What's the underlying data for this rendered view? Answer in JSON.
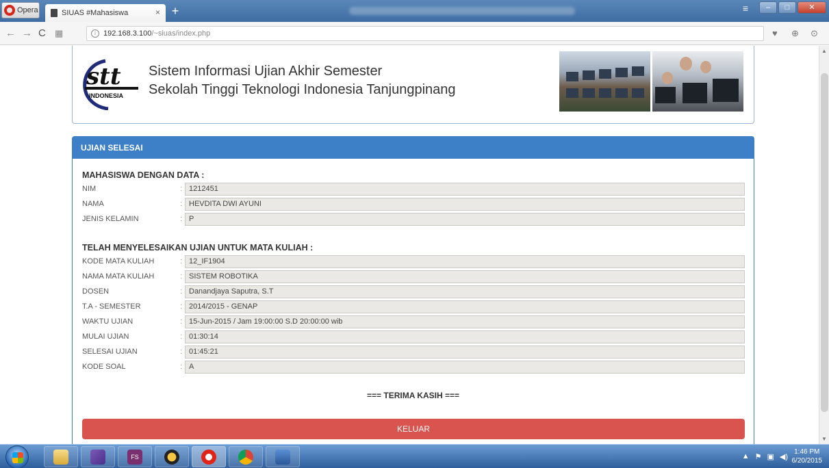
{
  "browser": {
    "menu_label": "Opera",
    "tab_title": "SIUAS #Mahasiswa",
    "tab_close": "×",
    "new_tab": "+",
    "url_host": "192.168.3.100",
    "url_path": "/~siuas/index.php"
  },
  "header": {
    "title_line1": "Sistem Informasi Ujian Akhir Semester",
    "title_line2": "Sekolah Tinggi Teknologi Indonesia Tanjungpinang",
    "logo_text": "stt",
    "logo_subtext": "INDONESIA"
  },
  "panel": {
    "heading": "UJIAN SELESAI",
    "student_section": "MAHASISWA DENGAN DATA :",
    "student_rows": [
      {
        "label": "NIM",
        "value": "1212451"
      },
      {
        "label": "NAMA",
        "value": "HEVDITA DWI AYUNI"
      },
      {
        "label": "JENIS KELAMIN",
        "value": "P"
      }
    ],
    "exam_section": "TELAH MENYELESAIKAN UJIAN UNTUK MATA KULIAH :",
    "exam_rows": [
      {
        "label": "KODE MATA KULIAH",
        "value": "12_IF1904"
      },
      {
        "label": "NAMA MATA KULIAH",
        "value": "SISTEM ROBOTIKA"
      },
      {
        "label": "DOSEN",
        "value": "Danandjaya Saputra, S.T"
      },
      {
        "label": "T.A - SEMESTER",
        "value": "2014/2015 - GENAP"
      },
      {
        "label": "WAKTU UJIAN",
        "value": "15-Jun-2015 / Jam 19:00:00 S.D 20:00:00 wib"
      },
      {
        "label": "MULAI UJIAN",
        "value": "01:30:14"
      },
      {
        "label": "SELESAI UJIAN",
        "value": "01:45:21"
      },
      {
        "label": "KODE SOAL",
        "value": "A"
      }
    ],
    "separator": ":",
    "thanks": "=== TERIMA KASIH ===",
    "logout_label": "KELUAR"
  },
  "taskbar": {
    "fs_label": "FS",
    "time": "1:46 PM",
    "date": "6/20/2015"
  },
  "colors": {
    "panel_header": "#3d80c7",
    "logout_button": "#d9534f",
    "field_bg": "#eae9e5"
  }
}
